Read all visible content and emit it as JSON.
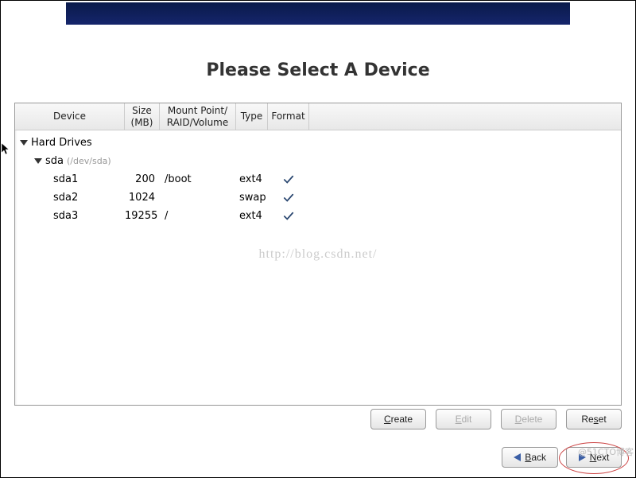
{
  "title": "Please Select A Device",
  "columns": {
    "device": "Device",
    "size": "Size\n(MB)",
    "mount": "Mount Point/\nRAID/Volume",
    "type": "Type",
    "format": "Format"
  },
  "tree": {
    "root_label": "Hard Drives",
    "disk": {
      "name": "sda",
      "path": "(/dev/sda)"
    }
  },
  "partitions": [
    {
      "device": "sda1",
      "size": "200",
      "mount": "/boot",
      "type": "ext4",
      "format": true
    },
    {
      "device": "sda2",
      "size": "1024",
      "mount": "",
      "type": "swap",
      "format": true
    },
    {
      "device": "sda3",
      "size": "19255",
      "mount": "/",
      "type": "ext4",
      "format": true
    }
  ],
  "watermark": "http://blog.csdn.net/",
  "buttons": {
    "create": "Create",
    "edit": "Edit",
    "delete": "Delete",
    "reset": "Reset",
    "back": "Back",
    "next": "Next"
  },
  "corner": "@51CTO博客"
}
